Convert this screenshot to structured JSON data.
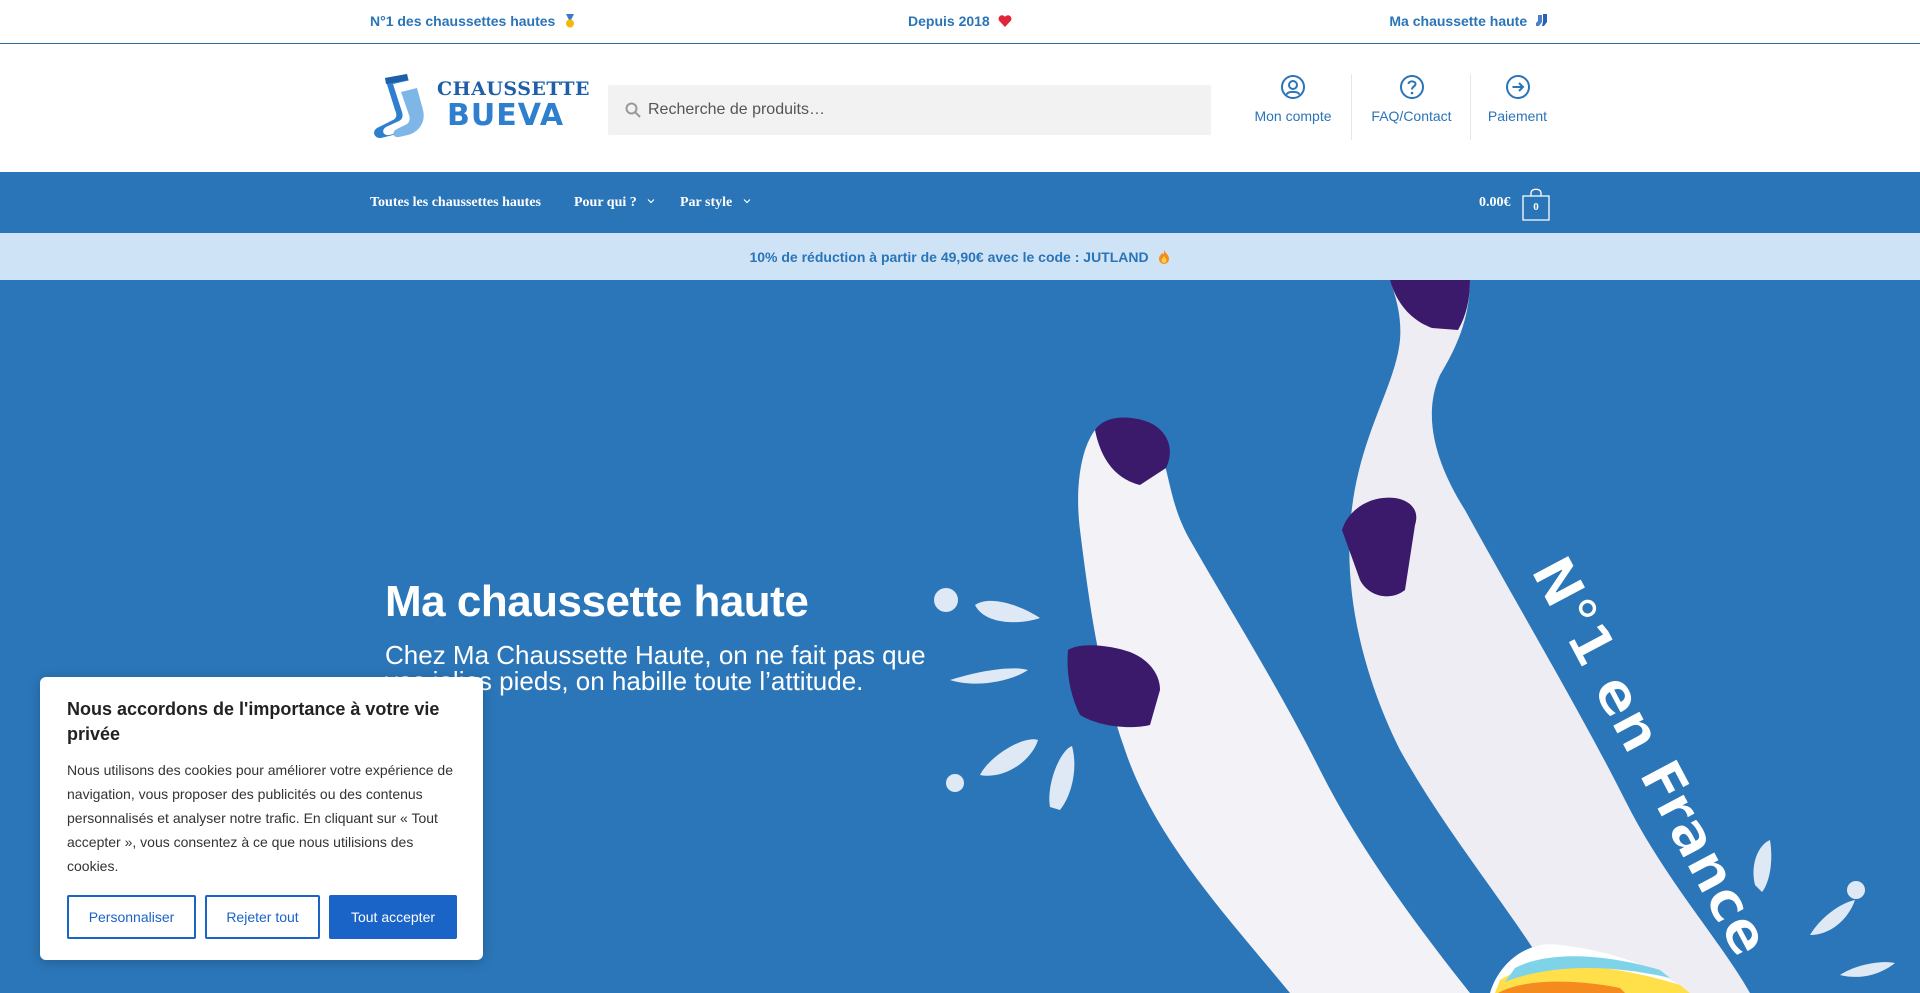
{
  "topbar": {
    "msg1": "N°1 des chaussettes hautes",
    "msg2": "Depuis 2018",
    "msg3": "Ma chaussette haute"
  },
  "header": {
    "logo_line1": "CHAUSSETTE",
    "logo_line2": "BUEVA",
    "search_placeholder": "Recherche de produits…",
    "links": {
      "account": "Mon compte",
      "faq": "FAQ/Contact",
      "payment": "Paiement"
    }
  },
  "nav": {
    "all": "Toutes les chaussettes hautes",
    "for_who": "Pour qui ?",
    "by_style": "Par style",
    "cart_total": "0.00€",
    "cart_count": "0"
  },
  "promo": {
    "text": "10% de réduction à partir de 49,90€ avec le code : JUTLAND"
  },
  "hero": {
    "title": "Ma chaussette haute",
    "subtitle": "Chez Ma Chaussette Haute, on ne fait pas que vos jolies pieds, on habille toute l’attitude.",
    "badge": "N°1 en France"
  },
  "cookie": {
    "title": "Nous accordons de l'importance à votre vie privée",
    "body": "Nous utilisons des cookies pour améliorer votre expérience de navigation, vous proposer des publicités ou des contenus personnalisés et analyser notre trafic. En cliquant sur « Tout accepter », vous consentez à ce que nous utilisions des cookies.",
    "customize": "Personnaliser",
    "reject": "Rejeter tout",
    "accept": "Tout accepter"
  },
  "colors": {
    "brand": "#2a74b8",
    "promo_bg": "#cfe3f7",
    "hero_bg": "#2b76b8",
    "button": "#1a63c7"
  }
}
